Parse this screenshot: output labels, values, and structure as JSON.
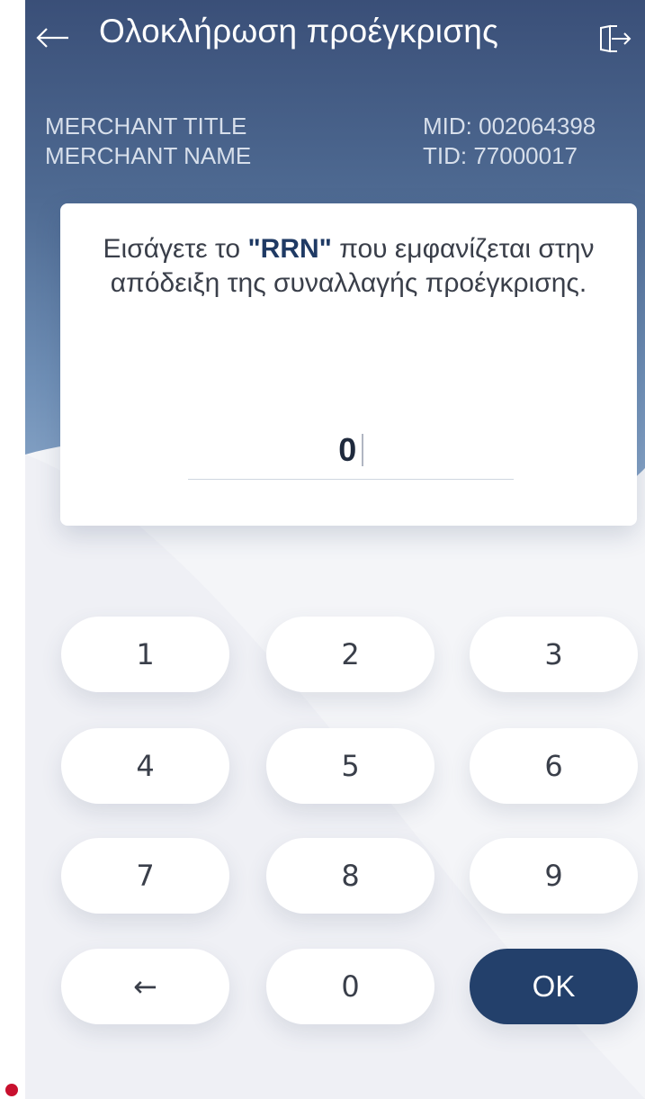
{
  "header": {
    "title": "Ολοκλήρωση προέγκρισης",
    "back_icon": "arrow-left-icon",
    "exit_icon": "exit-icon"
  },
  "merchant": {
    "title": "MERCHANT TITLE",
    "name": "MERCHANT NAME",
    "mid": "MID: 002064398",
    "tid": "TID: 77000017"
  },
  "prompt": {
    "text_before": "Εισάγετε το ",
    "highlight": "\"RRN\"",
    "text_after": " που εμφανίζεται στην απόδειξη της συναλλαγής προέγκρισης."
  },
  "rrn_input": {
    "value": "0"
  },
  "keypad": {
    "k1": "1",
    "k2": "2",
    "k3": "3",
    "k4": "4",
    "k5": "5",
    "k6": "6",
    "k7": "7",
    "k8": "8",
    "k9": "9",
    "backspace": "←",
    "k0": "0",
    "ok": "OK"
  },
  "colors": {
    "header_top": "#3a4f78",
    "header_bottom": "#8aa7c9",
    "primary": "#23406b",
    "brand": "#c8102e"
  }
}
